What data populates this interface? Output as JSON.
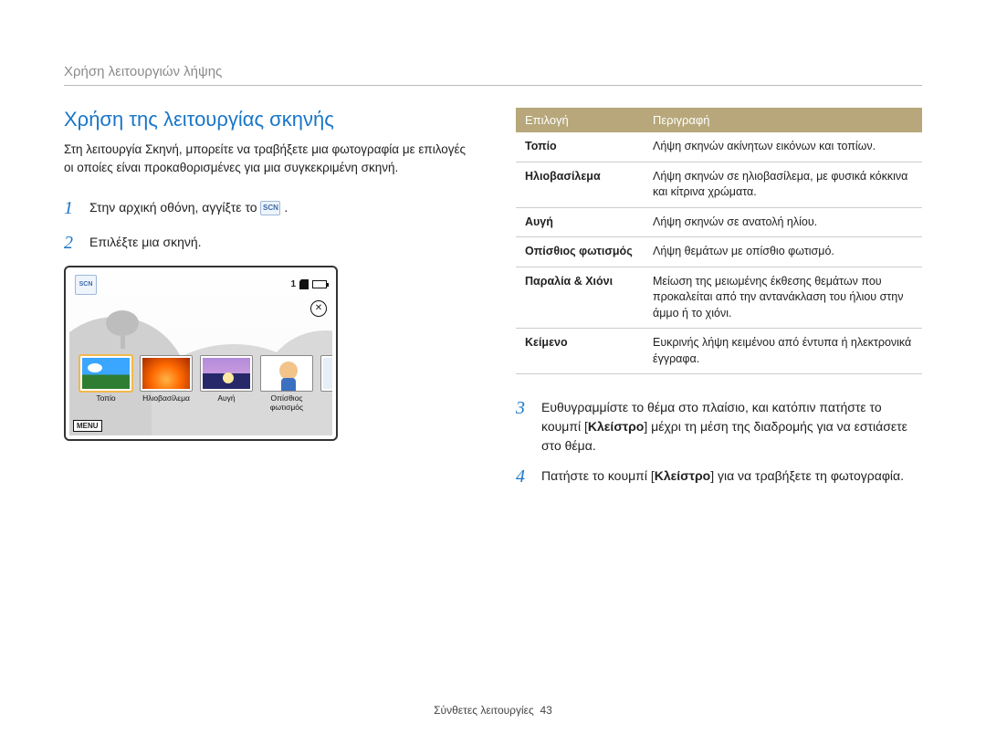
{
  "breadcrumb": "Χρήση λειτουργιών λήψης",
  "section_title": "Χρήση της λειτουργίας σκηνής",
  "intro": "Στη λειτουργία Σκηνή, μπορείτε να τραβήξετε μια φωτογραφία με επιλογές οι οποίες είναι προκαθορισμένες για μια συγκεκριμένη σκηνή.",
  "icon_scn_label": "SCN",
  "steps": {
    "s1_pre": "Στην αρχική οθόνη, αγγίξτε το ",
    "s1_post": " .",
    "s2": "Επιλέξτε μια σκηνή.",
    "s3_a": "Ευθυγραμμίστε το θέμα στο πλαίσιο, και κατόπιν πατήστε το κουμπί [",
    "s3_bold": "Κλείστρο",
    "s3_b": "] μέχρι τη μέση της διαδρομής για να εστιάσετε στο θέμα.",
    "s4_a": "Πατήστε το κουμπί [",
    "s4_bold": "Κλείστρο",
    "s4_b": "] για να τραβήξετε τη φωτογραφία."
  },
  "step_nums": {
    "n1": "1",
    "n2": "2",
    "n3": "3",
    "n4": "4"
  },
  "lcd": {
    "count": "1",
    "menu": "MENU",
    "scn": "SCN",
    "flash": "⊘",
    "scenes": [
      {
        "label": "Τοπίο"
      },
      {
        "label": "Ηλιοβασίλεμα"
      },
      {
        "label": "Αυγή"
      },
      {
        "label": "Οπίσθιος φωτισμός"
      }
    ]
  },
  "table": {
    "head_option": "Επιλογή",
    "head_desc": "Περιγραφή",
    "rows": [
      {
        "opt": "Τοπίο",
        "desc": "Λήψη σκηνών ακίνητων εικόνων και τοπίων."
      },
      {
        "opt": "Ηλιοβασίλεμα",
        "desc": "Λήψη σκηνών σε ηλιοβασίλεμα, με φυσικά κόκκινα και κίτρινα χρώματα."
      },
      {
        "opt": "Αυγή",
        "desc": "Λήψη σκηνών σε ανατολή ηλίου."
      },
      {
        "opt": "Οπίσθιος φωτισμός",
        "desc": "Λήψη θεμάτων με οπίσθιο φωτισμό."
      },
      {
        "opt": "Παραλία & Χιόνι",
        "desc": "Μείωση της μειωμένης έκθεσης θεμάτων που προκαλείται από την αντανάκλαση του ήλιου στην άμμο ή το χιόνι."
      },
      {
        "opt": "Κείμενο",
        "desc": "Ευκρινής λήψη κειμένου από έντυπα ή ηλεκτρονικά έγγραφα."
      }
    ]
  },
  "footer": {
    "label": "Σύνθετες λειτουργίες",
    "page": "43"
  }
}
